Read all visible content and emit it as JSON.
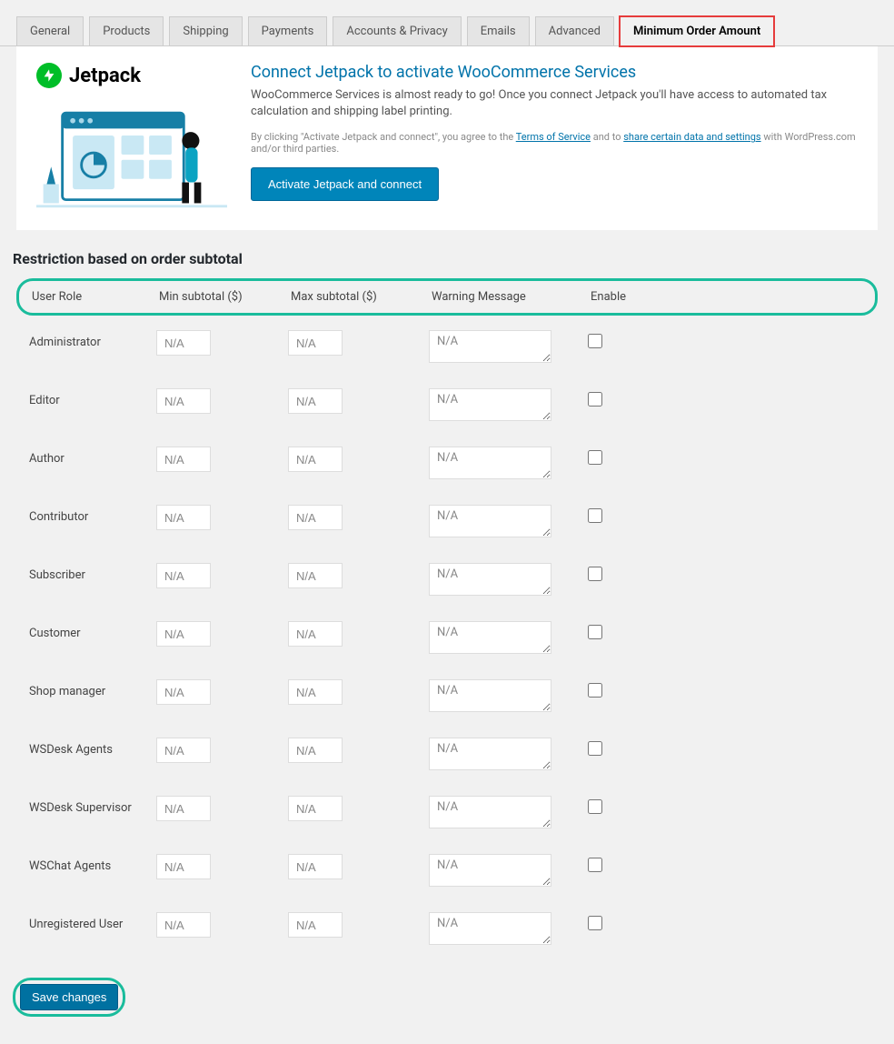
{
  "tabs": [
    {
      "label": "General"
    },
    {
      "label": "Products"
    },
    {
      "label": "Shipping"
    },
    {
      "label": "Payments"
    },
    {
      "label": "Accounts & Privacy"
    },
    {
      "label": "Emails"
    },
    {
      "label": "Advanced"
    },
    {
      "label": "Minimum Order Amount"
    }
  ],
  "banner": {
    "brand": "Jetpack",
    "title": "Connect Jetpack to activate WooCommerce Services",
    "desc": "WooCommerce Services is almost ready to go! Once you connect Jetpack you'll have access to automated tax calculation and shipping label printing.",
    "legal_prefix": "By clicking \"Activate Jetpack and connect\", you agree to the ",
    "tos_link": "Terms of Service",
    "legal_mid": " and to ",
    "share_link": "share certain data and settings",
    "legal_suffix": " with WordPress.com and/or third parties.",
    "button": "Activate Jetpack and connect"
  },
  "section_title": "Restriction based on order subtotal",
  "columns": {
    "role": "User Role",
    "min": "Min subtotal ($)",
    "max": "Max subtotal ($)",
    "warn": "Warning Message",
    "enable": "Enable"
  },
  "placeholder": {
    "na": "N/A"
  },
  "roles": [
    {
      "label": "Administrator"
    },
    {
      "label": "Editor"
    },
    {
      "label": "Author"
    },
    {
      "label": "Contributor"
    },
    {
      "label": "Subscriber"
    },
    {
      "label": "Customer"
    },
    {
      "label": "Shop manager"
    },
    {
      "label": "WSDesk Agents"
    },
    {
      "label": "WSDesk Supervisor"
    },
    {
      "label": "WSChat Agents"
    },
    {
      "label": "Unregistered User"
    }
  ],
  "save_button": "Save changes"
}
